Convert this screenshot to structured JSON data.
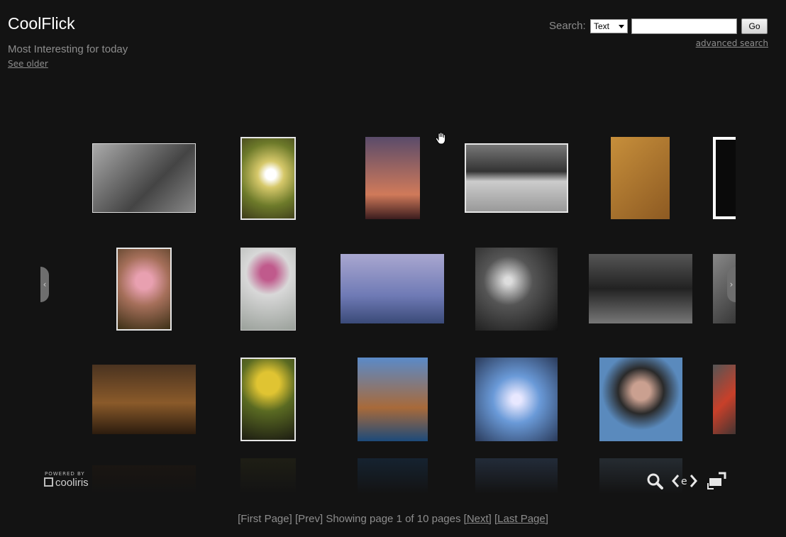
{
  "brand": "CoolFlick",
  "subtitle": "Most Interesting for today",
  "see_older": "See older",
  "search": {
    "label": "Search:",
    "select_value": "Text",
    "input_value": "",
    "button": "Go",
    "advanced": "advanced search"
  },
  "powered": {
    "small": "POWERED BY",
    "name": "cooliris"
  },
  "tools": [
    "search-icon",
    "embed-icon",
    "fullscreen-icon"
  ],
  "pager": {
    "first": "[First Page]",
    "prev": "[Prev]",
    "showing": "Showing page 1 of 10 pages",
    "next": "[Next]",
    "last": "[Last Page]"
  },
  "photos": [
    {
      "name": "photo-children-bw",
      "bg": "linear-gradient(135deg,#aaa,#444 60%,#888)"
    },
    {
      "name": "photo-daisy",
      "bg": "radial-gradient(circle at 55% 45%,#fff 10%,#d6c86a 25%,#6d7a2a 60%,#3c3a1a)"
    },
    {
      "name": "photo-girl-fence",
      "bg": "linear-gradient(180deg,#5a4b6a,#d07a5a 70%,#3b1c1e)"
    },
    {
      "name": "photo-pier-bw",
      "bg": "linear-gradient(180deg,#777 0%,#333 40%,#ccc 55%,#999 100%)"
    },
    {
      "name": "photo-desert-wall",
      "bg": "linear-gradient(135deg,#c78f3b,#8d5a22)"
    },
    {
      "name": "photo-partial-dark",
      "bg": "#0a0a0a"
    },
    {
      "name": "photo-pink-flowers",
      "bg": "radial-gradient(circle at 50% 40%,#e8a0b0 15%,#a56f5a 45%,#3c3016)"
    },
    {
      "name": "photo-rose-wall",
      "bg": "radial-gradient(circle at 50% 30%,#c05a8c 12%,#d8d8d8 35%,#9aa09a)"
    },
    {
      "name": "photo-lavender-field",
      "bg": "linear-gradient(180deg,#a9a7d0,#6f7ab5 60%,#3a4a78)"
    },
    {
      "name": "photo-chain-bokeh",
      "bg": "radial-gradient(circle at 40% 40%,#ddd 5%,#555 35%,#111)"
    },
    {
      "name": "photo-grill-bw",
      "bg": "linear-gradient(180deg,#555,#222 50%,#777)"
    },
    {
      "name": "photo-partial-rock",
      "bg": "linear-gradient(135deg,#888,#333)"
    },
    {
      "name": "photo-merry-christmas",
      "bg": "linear-gradient(180deg,#4a3320,#8a5a2a 55%,#2c1c0e)"
    },
    {
      "name": "photo-yellow-flower",
      "bg": "radial-gradient(circle at 50% 30%,#e0c432 18%,#5a6a22 45%,#1c1c12)"
    },
    {
      "name": "photo-mosque",
      "bg": "linear-gradient(180deg,#5a8ac8,#a86a3a 60%,#1c4a7a)"
    },
    {
      "name": "photo-blossom",
      "bg": "radial-gradient(circle at 50% 50%,#e8e8ff 8%,#6a9ad8 40%,#2a3a5a)"
    },
    {
      "name": "photo-smiling-woman",
      "bg": "radial-gradient(circle at 50% 40%,#caa090 14%,#2a2a2a 35%,#5a8abd 60%)"
    },
    {
      "name": "photo-partial-red",
      "bg": "linear-gradient(135deg,#555,#c8402a 50%,#333)"
    }
  ]
}
